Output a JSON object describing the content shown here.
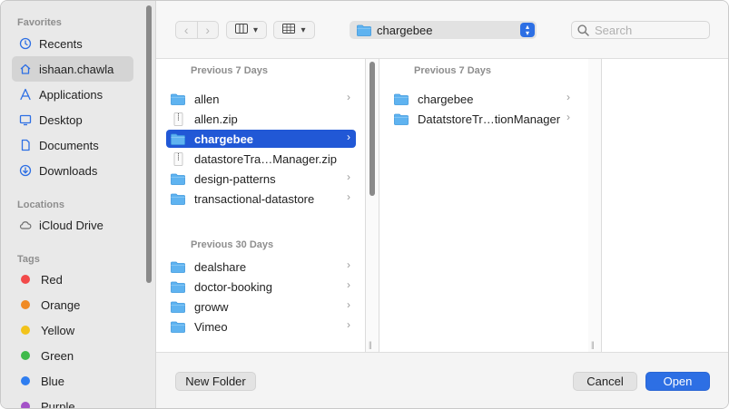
{
  "sidebar": {
    "favorites_title": "Favorites",
    "favorites": [
      {
        "label": "Recents",
        "icon": "clock-icon"
      },
      {
        "label": "ishaan.chawla",
        "icon": "home-icon"
      },
      {
        "label": "Applications",
        "icon": "applications-icon"
      },
      {
        "label": "Desktop",
        "icon": "desktop-icon"
      },
      {
        "label": "Documents",
        "icon": "document-icon"
      },
      {
        "label": "Downloads",
        "icon": "download-icon"
      }
    ],
    "locations_title": "Locations",
    "locations": [
      {
        "label": "iCloud Drive",
        "icon": "cloud-icon"
      }
    ],
    "tags_title": "Tags",
    "tags": [
      {
        "label": "Red",
        "color": "#f24a4a"
      },
      {
        "label": "Orange",
        "color": "#f08a24"
      },
      {
        "label": "Yellow",
        "color": "#f2c31b"
      },
      {
        "label": "Green",
        "color": "#3fba4a"
      },
      {
        "label": "Blue",
        "color": "#2f7ef0"
      },
      {
        "label": "Purple",
        "color": "#a452c8"
      }
    ]
  },
  "toolbar": {
    "back_icon": "chevron-left-icon",
    "forward_icon": "chevron-right-icon",
    "view_icon": "columns-view-icon",
    "group_icon": "grid-view-icon",
    "location": "chargebee",
    "search_placeholder": "Search"
  },
  "column1": {
    "section1_title": "Previous 7 Days",
    "section1_items": [
      {
        "label": "allen",
        "type": "folder"
      },
      {
        "label": "allen.zip",
        "type": "zip"
      },
      {
        "label": "chargebee",
        "type": "folder",
        "selected": true
      },
      {
        "label": "datastoreTra…Manager.zip",
        "type": "zip"
      },
      {
        "label": "design-patterns",
        "type": "folder"
      },
      {
        "label": "transactional-datastore",
        "type": "folder"
      }
    ],
    "section2_title": "Previous 30 Days",
    "section2_items": [
      {
        "label": "dealshare",
        "type": "folder"
      },
      {
        "label": "doctor-booking",
        "type": "folder"
      },
      {
        "label": "groww",
        "type": "folder"
      },
      {
        "label": "Vimeo",
        "type": "folder"
      }
    ]
  },
  "column2": {
    "section1_title": "Previous 7 Days",
    "items": [
      {
        "label": "chargebee",
        "type": "folder"
      },
      {
        "label": "DatatstoreTr…tionManager",
        "type": "folder"
      }
    ]
  },
  "footer": {
    "new_folder_label": "New Folder",
    "cancel_label": "Cancel",
    "open_label": "Open"
  },
  "colors": {
    "accent": "#2d6fe4",
    "selection": "#2158d6",
    "folder": "#5fb3f0"
  }
}
